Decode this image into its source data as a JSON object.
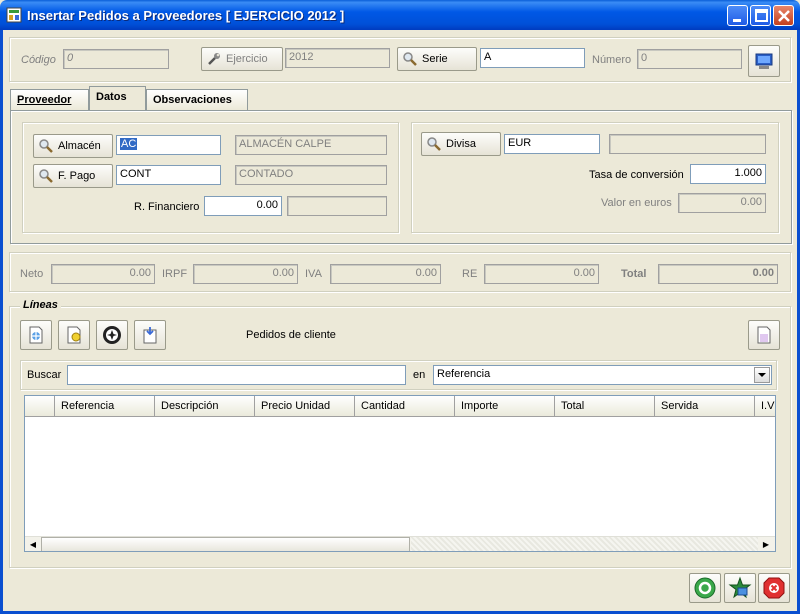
{
  "window": {
    "title": "Insertar Pedidos a Proveedores [ EJERCICIO 2012 ]"
  },
  "header": {
    "codigo_label": "Código",
    "codigo_value": "0",
    "ejercicio_label": "Ejercicio",
    "ejercicio_value": "2012",
    "serie_label": "Serie",
    "serie_value": "A",
    "numero_label": "Número",
    "numero_value": "0"
  },
  "tabs": [
    {
      "label": "Proveedor",
      "active": false
    },
    {
      "label": "Datos",
      "active": true
    },
    {
      "label": "Observaciones",
      "active": false
    }
  ],
  "datos": {
    "almacen_label": "Almacén",
    "almacen_code": "AC",
    "almacen_name": "ALMACÉN CALPE",
    "fpago_label": "F. Pago",
    "fpago_code": "CONT",
    "fpago_name": "CONTADO",
    "rfinanciero_label": "R. Financiero",
    "rfinanciero_value": "0.00",
    "rfinanciero_extra": "",
    "divisa_label": "Divisa",
    "divisa_value": "EUR",
    "divisa_name": "",
    "tasa_label": "Tasa de conversión",
    "tasa_value": "1.000",
    "valor_label": "Valor en euros",
    "valor_value": "0.00"
  },
  "totals": {
    "neto_label": "Neto",
    "neto_value": "0.00",
    "irpf_label": "IRPF",
    "irpf_value": "0.00",
    "iva_label": "IVA",
    "iva_value": "0.00",
    "re_label": "RE",
    "re_value": "0.00",
    "total_label": "Total",
    "total_value": "0.00"
  },
  "lineas": {
    "group_label": "Líneas",
    "pedidos_label": "Pedidos de cliente",
    "buscar_label": "Buscar",
    "buscar_value": "",
    "en_label": "en",
    "en_value": "Referencia",
    "columns": [
      "Referencia",
      "Descripción",
      "Precio Unidad",
      "Cantidad",
      "Importe",
      "Total",
      "Servida",
      "I.V"
    ]
  },
  "colors": {
    "titlebar": "#0058e6",
    "window_bg": "#ece9d8",
    "selection": "#316ac5"
  },
  "icons": [
    "app-icon",
    "minimize-icon",
    "maximize-icon",
    "close-icon",
    "wrench-icon",
    "magnifier-icon",
    "monitor-icon",
    "new-line-icon",
    "edit-line-icon",
    "delete-line-icon",
    "paste-line-icon",
    "document-icon",
    "refresh-icon",
    "save-icon",
    "cancel-icon"
  ]
}
